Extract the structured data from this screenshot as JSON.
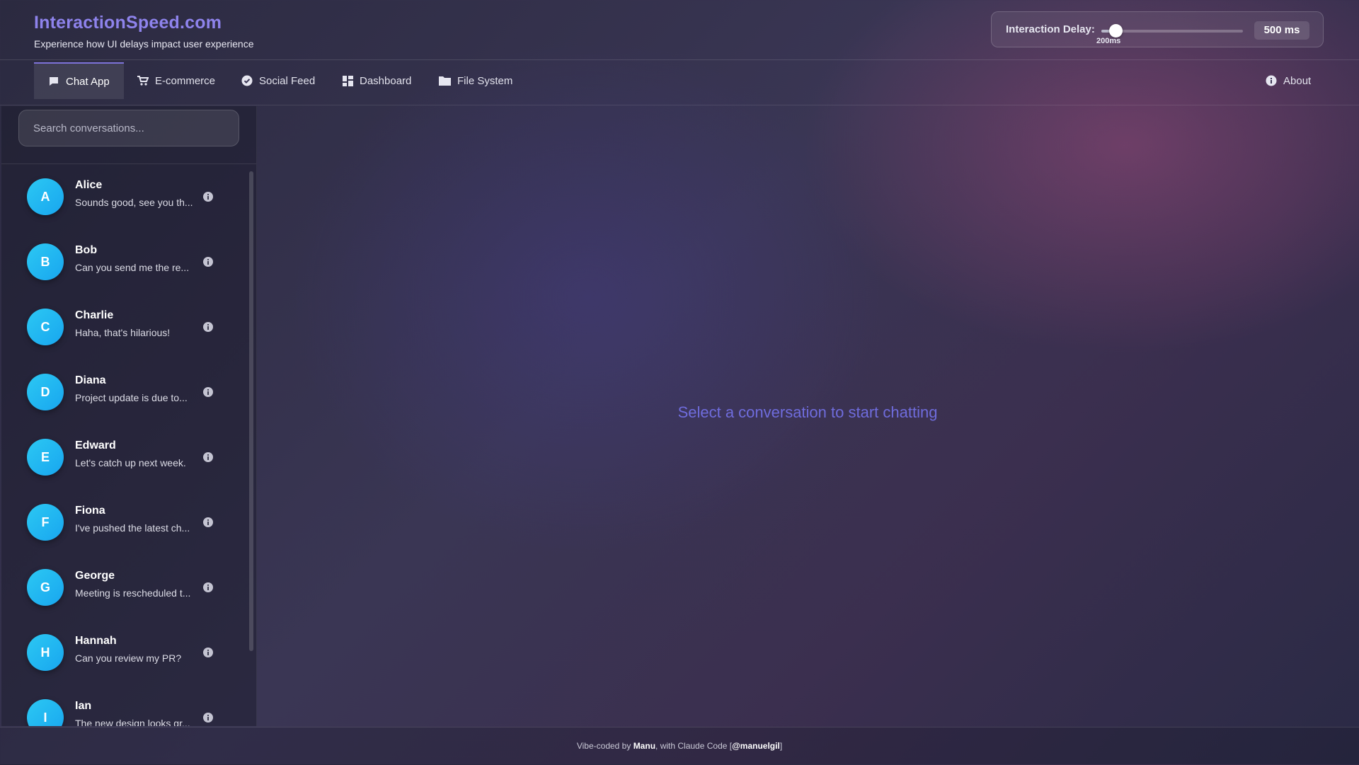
{
  "brand": {
    "title": "InteractionSpeed.com",
    "subtitle": "Experience how UI delays impact user experience"
  },
  "delay": {
    "label": "Interaction Delay:",
    "value_label": "500 ms",
    "min_label": "200ms",
    "slider_fraction": 0.1
  },
  "nav": {
    "tabs": [
      {
        "label": "Chat App",
        "icon": "chat-icon",
        "active": true
      },
      {
        "label": "E-commerce",
        "icon": "cart-icon",
        "active": false
      },
      {
        "label": "Social Feed",
        "icon": "check-circle-icon",
        "active": false
      },
      {
        "label": "Dashboard",
        "icon": "dashboard-icon",
        "active": false
      },
      {
        "label": "File System",
        "icon": "folder-icon",
        "active": false
      }
    ],
    "about": {
      "label": "About",
      "icon": "info-icon"
    }
  },
  "sidebar": {
    "search_placeholder": "Search conversations...",
    "conversations": [
      {
        "initial": "A",
        "name": "Alice",
        "preview": "Sounds good, see you th..."
      },
      {
        "initial": "B",
        "name": "Bob",
        "preview": "Can you send me the re..."
      },
      {
        "initial": "C",
        "name": "Charlie",
        "preview": "Haha, that's hilarious!"
      },
      {
        "initial": "D",
        "name": "Diana",
        "preview": "Project update is due to..."
      },
      {
        "initial": "E",
        "name": "Edward",
        "preview": "Let's catch up next week."
      },
      {
        "initial": "F",
        "name": "Fiona",
        "preview": "I've pushed the latest ch..."
      },
      {
        "initial": "G",
        "name": "George",
        "preview": "Meeting is rescheduled t..."
      },
      {
        "initial": "H",
        "name": "Hannah",
        "preview": "Can you review my PR?"
      },
      {
        "initial": "I",
        "name": "Ian",
        "preview": "The new design looks gr..."
      }
    ]
  },
  "main": {
    "empty_message": "Select a conversation to start chatting"
  },
  "footer": {
    "prefix": "Vibe-coded by ",
    "author": "Manu",
    "middle": ", with Claude Code [",
    "handle": "@manuelgil",
    "suffix": "]"
  },
  "colors": {
    "accent": "#8e83ec",
    "avatar": "#22b8f2",
    "empty_text": "#6f6cdc"
  }
}
